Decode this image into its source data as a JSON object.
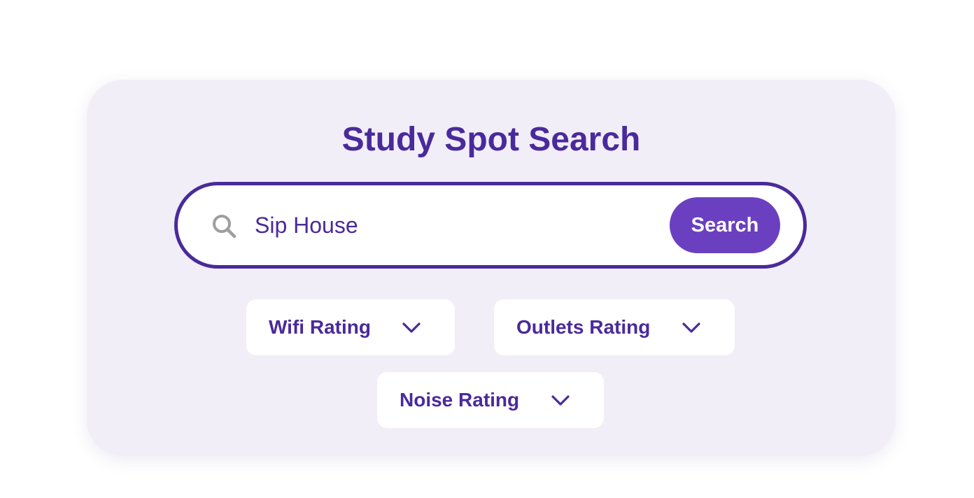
{
  "header": {
    "title": "Study Spot Search"
  },
  "search": {
    "value": "Sip House",
    "button_label": "Search",
    "icon": "search-icon"
  },
  "filters": [
    {
      "label": "Wifi Rating",
      "icon": "chevron-down-icon"
    },
    {
      "label": "Outlets Rating",
      "icon": "chevron-down-icon"
    },
    {
      "label": "Noise Rating",
      "icon": "chevron-down-icon"
    }
  ],
  "colors": {
    "primary": "#4a2a9b",
    "button": "#6a40c0",
    "card_background": "#f1eef8",
    "icon_gray": "#9e9e9e"
  }
}
